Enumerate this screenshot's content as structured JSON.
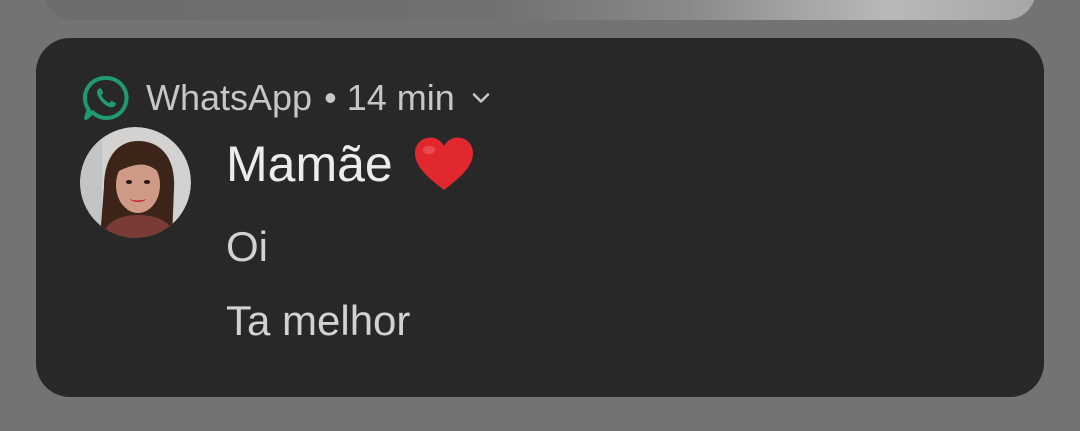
{
  "notification": {
    "app_name": "WhatsApp",
    "separator": "•",
    "time": "14 min",
    "app_icon": "whatsapp-icon",
    "expand_icon": "chevron-down-icon",
    "sender_name": "Mamãe",
    "sender_emoji": "red-heart-emoji",
    "messages": [
      "Oi",
      "Ta melhor"
    ],
    "colors": {
      "card_background": "#282828",
      "screen_background": "#737373",
      "whatsapp_green": "#1F9B6E",
      "heart_red": "#E0282E"
    }
  }
}
